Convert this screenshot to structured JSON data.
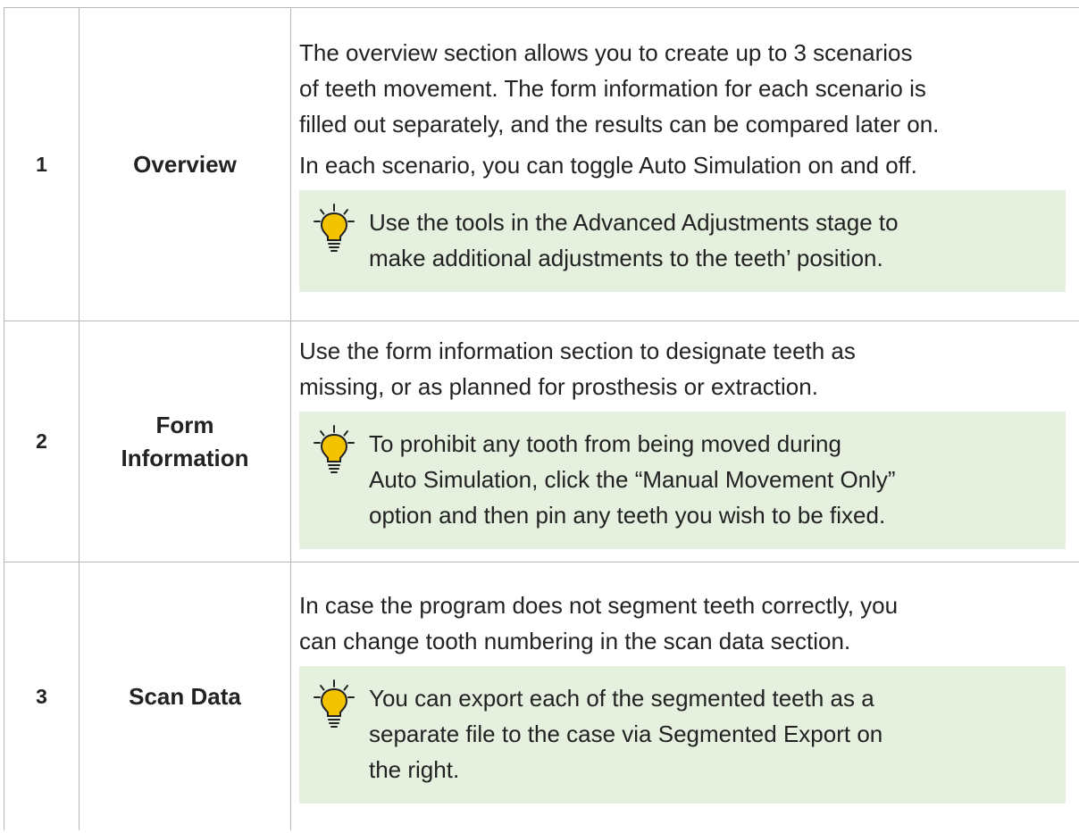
{
  "rows": [
    {
      "number": "1",
      "name": "Overview",
      "paragraphs": [
        "The overview section allows you to create up to 3 scenarios\nof teeth movement. The form information for each scenario is\nfilled out separately, and the results can be compared later on.",
        "In each scenario, you can toggle Auto Simulation on and off."
      ],
      "tip": "Use the tools in the Advanced Adjustments stage to\nmake additional adjustments to the teeth’ position."
    },
    {
      "number": "2",
      "name": "Form\nInformation",
      "paragraphs": [
        "Use the form information section to designate teeth as\nmissing, or as planned for prosthesis or extraction."
      ],
      "tip": "To prohibit any tooth from being moved during\nAuto Simulation, click the “Manual Movement Only”\noption and then pin any teeth you wish to be fixed."
    },
    {
      "number": "3",
      "name": "Scan Data",
      "paragraphs": [
        "In case the program does not segment teeth correctly, you\ncan change tooth numbering in the scan data section."
      ],
      "tip": "You can export each of the segmented teeth as a\nseparate file to the case via Segmented Export on\nthe right."
    }
  ],
  "icons": {
    "tip": "lightbulb-icon"
  },
  "colors": {
    "tip_background": "#e6f0df",
    "bulb": "#f4c300",
    "border": "#b8b8b8"
  }
}
